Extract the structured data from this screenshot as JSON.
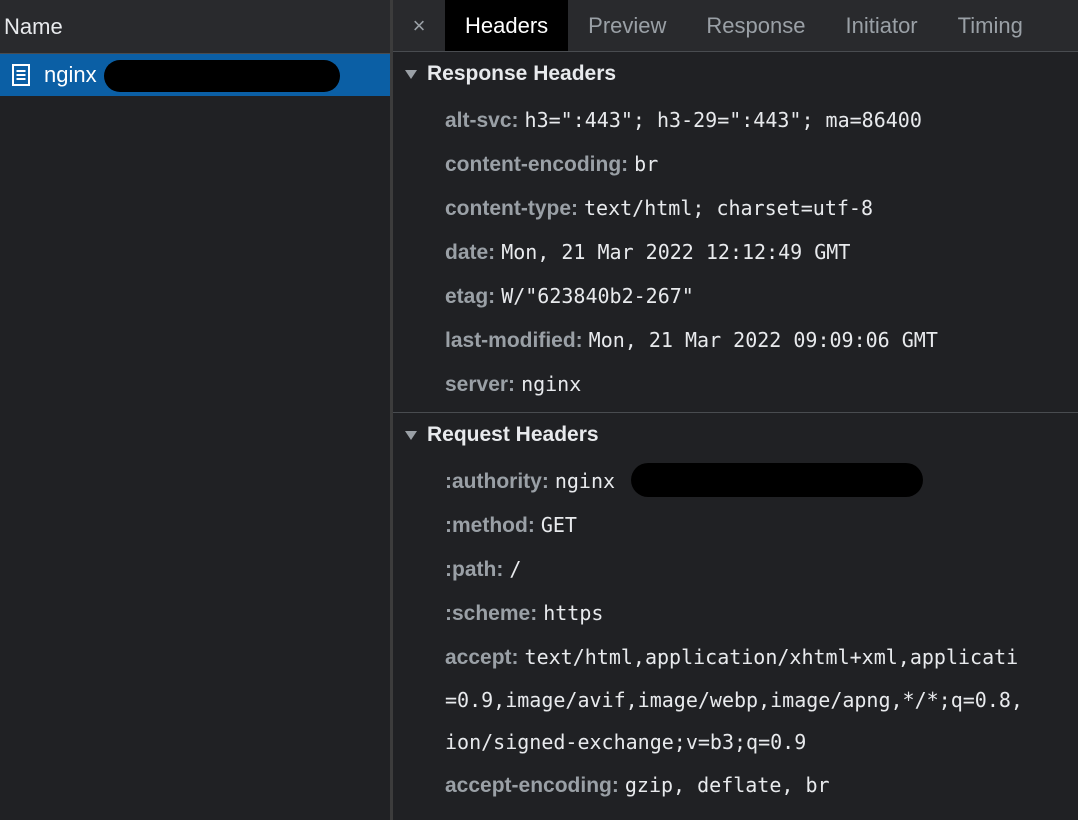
{
  "request_list": {
    "column_name": "Name",
    "selected_request": {
      "name": "nginx"
    }
  },
  "tabs": {
    "close_glyph": "×",
    "items": [
      {
        "label": "Headers",
        "active": true
      },
      {
        "label": "Preview"
      },
      {
        "label": "Response"
      },
      {
        "label": "Initiator"
      },
      {
        "label": "Timing"
      }
    ]
  },
  "response_headers": {
    "title": "Response Headers",
    "items": [
      {
        "key": "alt-svc:",
        "value": "h3=\":443\"; h3-29=\":443\"; ma=86400"
      },
      {
        "key": "content-encoding:",
        "value": "br"
      },
      {
        "key": "content-type:",
        "value": "text/html; charset=utf-8"
      },
      {
        "key": "date:",
        "value": "Mon, 21 Mar 2022 12:12:49 GMT"
      },
      {
        "key": "etag:",
        "value": "W/\"623840b2-267\""
      },
      {
        "key": "last-modified:",
        "value": "Mon, 21 Mar 2022 09:09:06 GMT"
      },
      {
        "key": "server:",
        "value": "nginx"
      }
    ]
  },
  "request_headers": {
    "title": "Request Headers",
    "items": [
      {
        "key": ":authority:",
        "value": "nginx"
      },
      {
        "key": ":method:",
        "value": "GET"
      },
      {
        "key": ":path:",
        "value": "/"
      },
      {
        "key": ":scheme:",
        "value": "https"
      },
      {
        "key": "accept:",
        "value": "text/html,application/xhtml+xml,applicati"
      },
      {
        "key": "accept-encoding:",
        "value": "gzip, deflate, br"
      }
    ],
    "accept_continuation": [
      "=0.9,image/avif,image/webp,image/apng,*/*;q=0.8,",
      "ion/signed-exchange;v=b3;q=0.9"
    ]
  },
  "colors": {
    "selected_row": "#0b5fa5",
    "panel_bg": "#202124",
    "header_bg": "#292a2d",
    "key_color": "#9aa0a6",
    "value_color": "#e8eaed"
  }
}
